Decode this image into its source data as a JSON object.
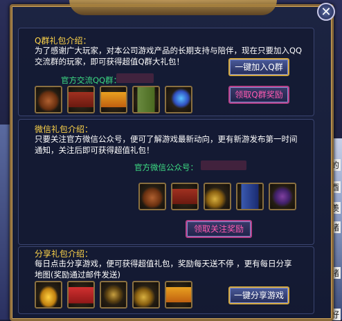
{
  "dialog": {
    "close_label": "✕"
  },
  "qq": {
    "title": "Q群礼包介绍：",
    "desc_line1": "为了感谢广大玩家，对本公司游戏产品的长期支持与陪伴，现在只要加入QQ",
    "desc_line2": "交流群的玩家，即可获得超值Q群大礼包！",
    "group_label": "官方交流QQ群：",
    "join_button": "一键加入Q群",
    "claim_button": "领取Q群奖励",
    "items": [
      "bag-icon",
      "red-chest-icon",
      "gold-chest-icon",
      "green-book-icon",
      "potion-icon"
    ]
  },
  "wechat": {
    "title": "微信礼包介绍：",
    "desc_line1": "只要关注官方微信公众号，便可了解游戏最新动向，更有新游发布第一时间",
    "desc_line2": "通知，关注后即可获得超值礼包！",
    "account_label": "官方微信公众号：",
    "claim_button": "领取关注奖励",
    "items": [
      "bag-icon",
      "red-chest-icon",
      "coins-icon",
      "blue-book-icon",
      "scroll-icon"
    ]
  },
  "share": {
    "title": "分享礼包介绍：",
    "desc_line1": "每日点击分享游戏，便可获得超值礼包，奖励每天送不停 ，更有每日分享",
    "desc_line2": "地图(奖励通过邮件发送)",
    "share_button": "一键分享游戏",
    "items": [
      "gold-ingot-icon",
      "red-gift-icon",
      "amulet-icon",
      "coins-icon",
      "gold-chest-icon"
    ]
  },
  "background_right_text": [
    "戏的",
    "酉",
    "是羡",
    "段諸",
    "绪",
    "好"
  ]
}
